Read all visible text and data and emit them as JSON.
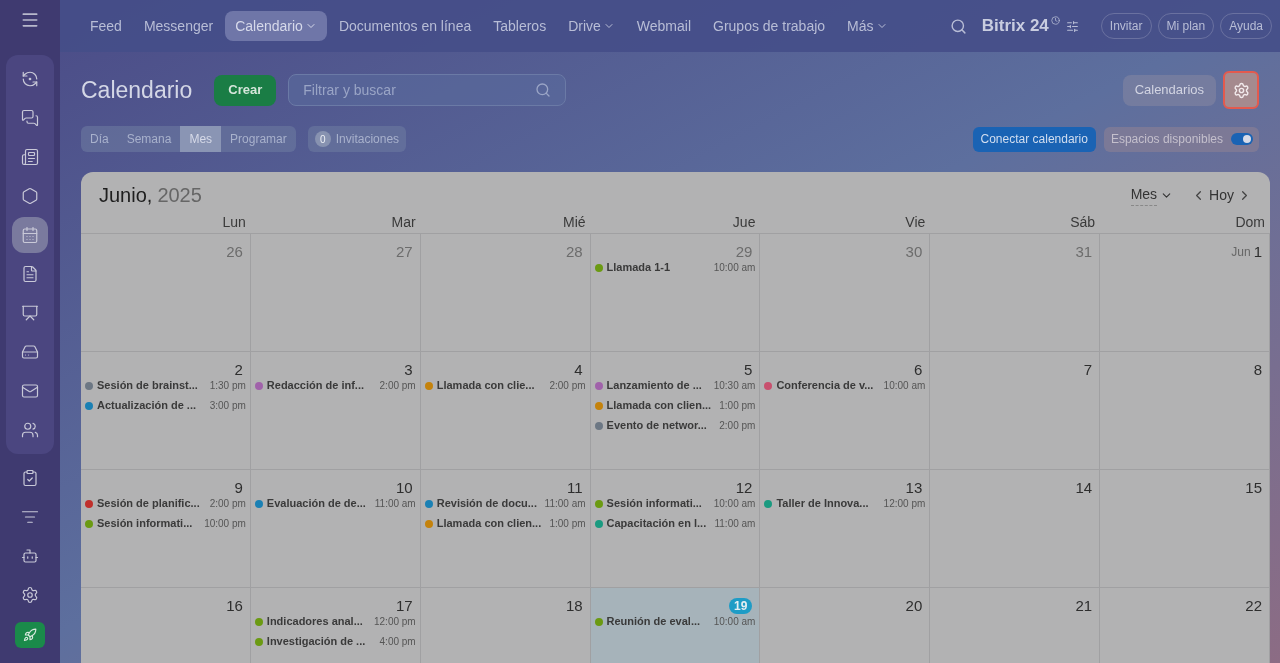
{
  "nav": {
    "items": [
      {
        "label": "Feed",
        "selected": false,
        "dropdown": false
      },
      {
        "label": "Messenger",
        "selected": false,
        "dropdown": false
      },
      {
        "label": "Calendario",
        "selected": true,
        "dropdown": true
      },
      {
        "label": "Documentos en línea",
        "selected": false,
        "dropdown": false
      },
      {
        "label": "Tableros",
        "selected": false,
        "dropdown": false
      },
      {
        "label": "Drive",
        "selected": false,
        "dropdown": true
      },
      {
        "label": "Webmail",
        "selected": false,
        "dropdown": false
      },
      {
        "label": "Grupos de trabajo",
        "selected": false,
        "dropdown": false
      },
      {
        "label": "Más",
        "selected": false,
        "dropdown": true
      }
    ],
    "logo": "Bitrix 24",
    "buttons": [
      "Invitar",
      "Mi plan",
      "Ayuda"
    ]
  },
  "sidebar": {
    "items": [
      {
        "selected": false
      },
      {
        "selected": false
      },
      {
        "selected": false
      },
      {
        "selected": false
      },
      {
        "selected": true
      },
      {
        "selected": false
      },
      {
        "selected": false
      },
      {
        "selected": false
      },
      {
        "selected": false
      },
      {
        "selected": false
      },
      {
        "selected": false
      },
      {
        "selected": false
      },
      {
        "selected": false
      },
      {
        "selected": false
      }
    ]
  },
  "toolbar": {
    "title": "Calendario",
    "create": "Crear",
    "search": {
      "placeholder": "Filtrar y buscar"
    },
    "calendars": "Calendarios",
    "settings": {
      "highlighted": true
    },
    "views": [
      {
        "label": "Día",
        "selected": false
      },
      {
        "label": "Semana",
        "selected": false
      },
      {
        "label": "Mes",
        "selected": true
      },
      {
        "label": "Programar",
        "selected": false
      }
    ],
    "invitations": {
      "count": "0",
      "label": "Invitaciones"
    },
    "connect": "Conectar calendario",
    "free_slots": {
      "label": "Espacios disponibles",
      "on": true
    }
  },
  "calendar": {
    "month": "Junio,",
    "year": "2025",
    "view": "Mes",
    "today": "Hoy",
    "weekdays": [
      "Lun",
      "Mar",
      "Mié",
      "Jue",
      "Vie",
      "Sáb",
      "Dom"
    ],
    "weeks": [
      [
        {
          "date": "26",
          "muted": true,
          "today": false
        },
        {
          "date": "27",
          "muted": true,
          "today": false
        },
        {
          "date": "28",
          "muted": true,
          "today": false
        },
        {
          "date": "29",
          "muted": true,
          "today": false,
          "events": [
            {
              "title": "Llamada 1-1",
              "time": "10:00 am",
              "color": "#6b9a12"
            }
          ]
        },
        {
          "date": "30",
          "muted": true,
          "today": false
        },
        {
          "date": "31",
          "muted": true,
          "today": false
        },
        {
          "date": "1",
          "prefix": "Jun",
          "muted": false,
          "today": false
        }
      ],
      [
        {
          "date": "2",
          "muted": false,
          "today": false,
          "events": [
            {
              "title": "Sesión de brainst...",
              "time": "1:30 pm",
              "color": "#6c7784"
            },
            {
              "title": "Actualización de ...",
              "time": "3:00 pm",
              "color": "#1a80b4"
            }
          ]
        },
        {
          "date": "3",
          "muted": false,
          "today": false,
          "events": [
            {
              "title": "Redacción de inf...",
              "time": "2:00 pm",
              "color": "#a062aa"
            }
          ]
        },
        {
          "date": "4",
          "muted": false,
          "today": false,
          "events": [
            {
              "title": "Llamada con clie...",
              "time": "2:00 pm",
              "color": "#c4820c"
            }
          ]
        },
        {
          "date": "5",
          "muted": false,
          "today": false,
          "events": [
            {
              "title": "Lanzamiento de ...",
              "time": "10:30 am",
              "color": "#a062aa"
            },
            {
              "title": "Llamada con clien...",
              "time": "1:00 pm",
              "color": "#c4820c"
            },
            {
              "title": "Evento de networ...",
              "time": "2:00 pm",
              "color": "#6c7784"
            }
          ]
        },
        {
          "date": "6",
          "muted": false,
          "today": false,
          "events": [
            {
              "title": "Conferencia de v...",
              "time": "10:00 am",
              "color": "#c8506e"
            }
          ]
        },
        {
          "date": "7",
          "muted": false,
          "today": false
        },
        {
          "date": "8",
          "muted": false,
          "today": false
        }
      ],
      [
        {
          "date": "9",
          "muted": false,
          "today": false,
          "events": [
            {
              "title": "Sesión de planific...",
              "time": "2:00 pm",
              "color": "#c0302c"
            },
            {
              "title": "Sesión informati...",
              "time": "10:00 pm",
              "color": "#6b9a12"
            }
          ]
        },
        {
          "date": "10",
          "muted": false,
          "today": false,
          "events": [
            {
              "title": "Evaluación de de...",
              "time": "11:00 am",
              "color": "#1a80b4"
            }
          ]
        },
        {
          "date": "11",
          "muted": false,
          "today": false,
          "events": [
            {
              "title": "Revisión de docu...",
              "time": "11:00 am",
              "color": "#1a80b4"
            },
            {
              "title": "Llamada con clien...",
              "time": "1:00 pm",
              "color": "#c4820c"
            }
          ]
        },
        {
          "date": "12",
          "muted": false,
          "today": false,
          "events": [
            {
              "title": "Sesión informati...",
              "time": "10:00 am",
              "color": "#6b9a12"
            },
            {
              "title": "Capacitación en l...",
              "time": "11:00 am",
              "color": "#1a9a80"
            }
          ]
        },
        {
          "date": "13",
          "muted": false,
          "today": false,
          "events": [
            {
              "title": "Taller de Innova...",
              "time": "12:00 pm",
              "color": "#1a9a80"
            }
          ]
        },
        {
          "date": "14",
          "muted": false,
          "today": false
        },
        {
          "date": "15",
          "muted": false,
          "today": false
        }
      ],
      [
        {
          "date": "16",
          "muted": false,
          "today": false
        },
        {
          "date": "17",
          "muted": false,
          "today": false,
          "events": [
            {
              "title": "Indicadores anal...",
              "time": "12:00 pm",
              "color": "#6b9a12"
            },
            {
              "title": "Investigación de ...",
              "time": "4:00 pm",
              "color": "#6b9a12"
            }
          ]
        },
        {
          "date": "18",
          "muted": false,
          "today": false
        },
        {
          "date": "19",
          "muted": false,
          "today": true,
          "events": [
            {
              "title": "Reunión de eval...",
              "time": "10:00 am",
              "color": "#6b9a12"
            }
          ]
        },
        {
          "date": "20",
          "muted": false,
          "today": false
        },
        {
          "date": "21",
          "muted": false,
          "today": false
        },
        {
          "date": "22",
          "muted": false,
          "today": false
        }
      ]
    ]
  }
}
